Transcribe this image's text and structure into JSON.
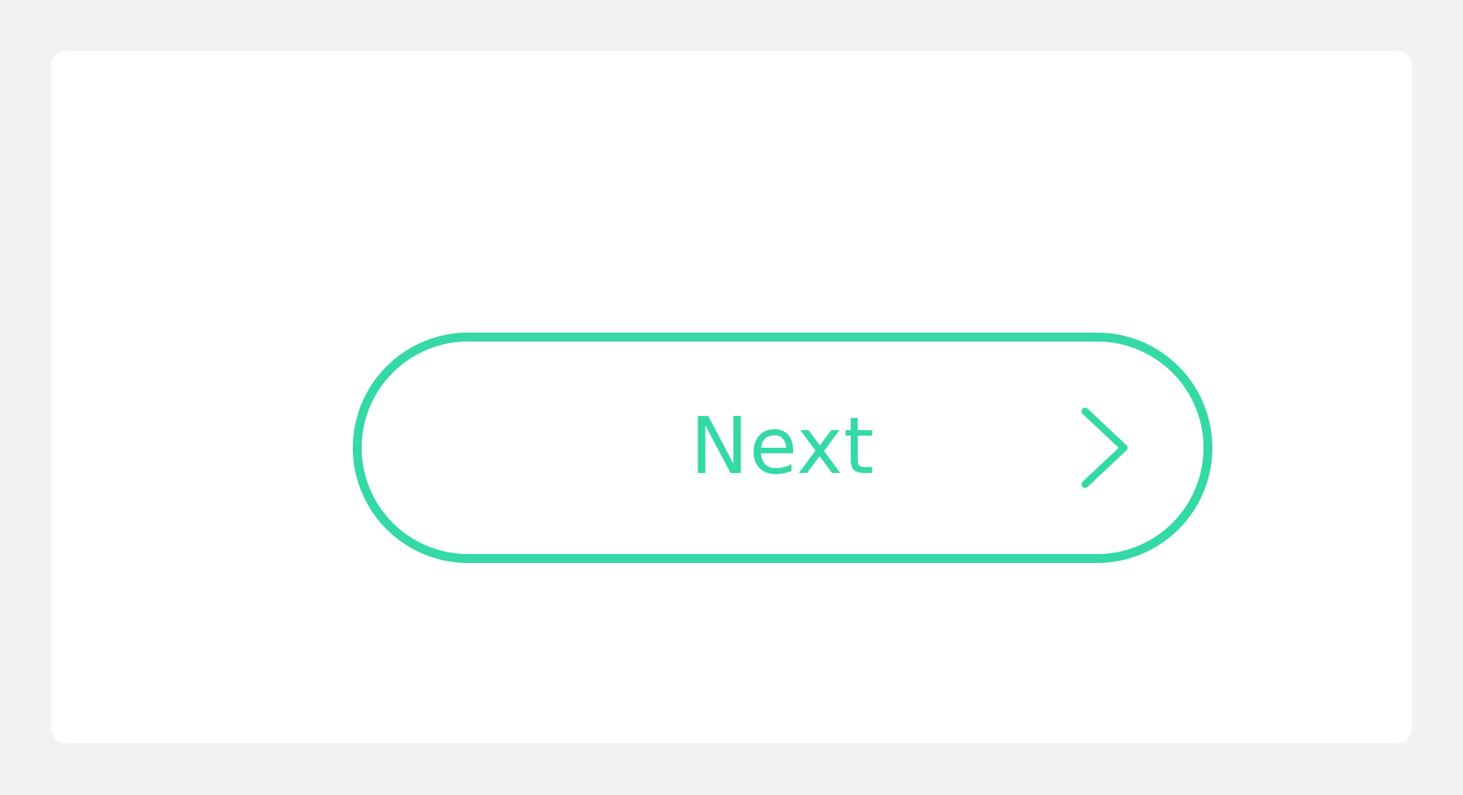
{
  "button": {
    "label": "Next",
    "icon": "chevron-right-icon",
    "accent_color": "#34d9a5"
  },
  "colors": {
    "page_background": "#f2f2f2",
    "card_background": "#ffffff"
  }
}
